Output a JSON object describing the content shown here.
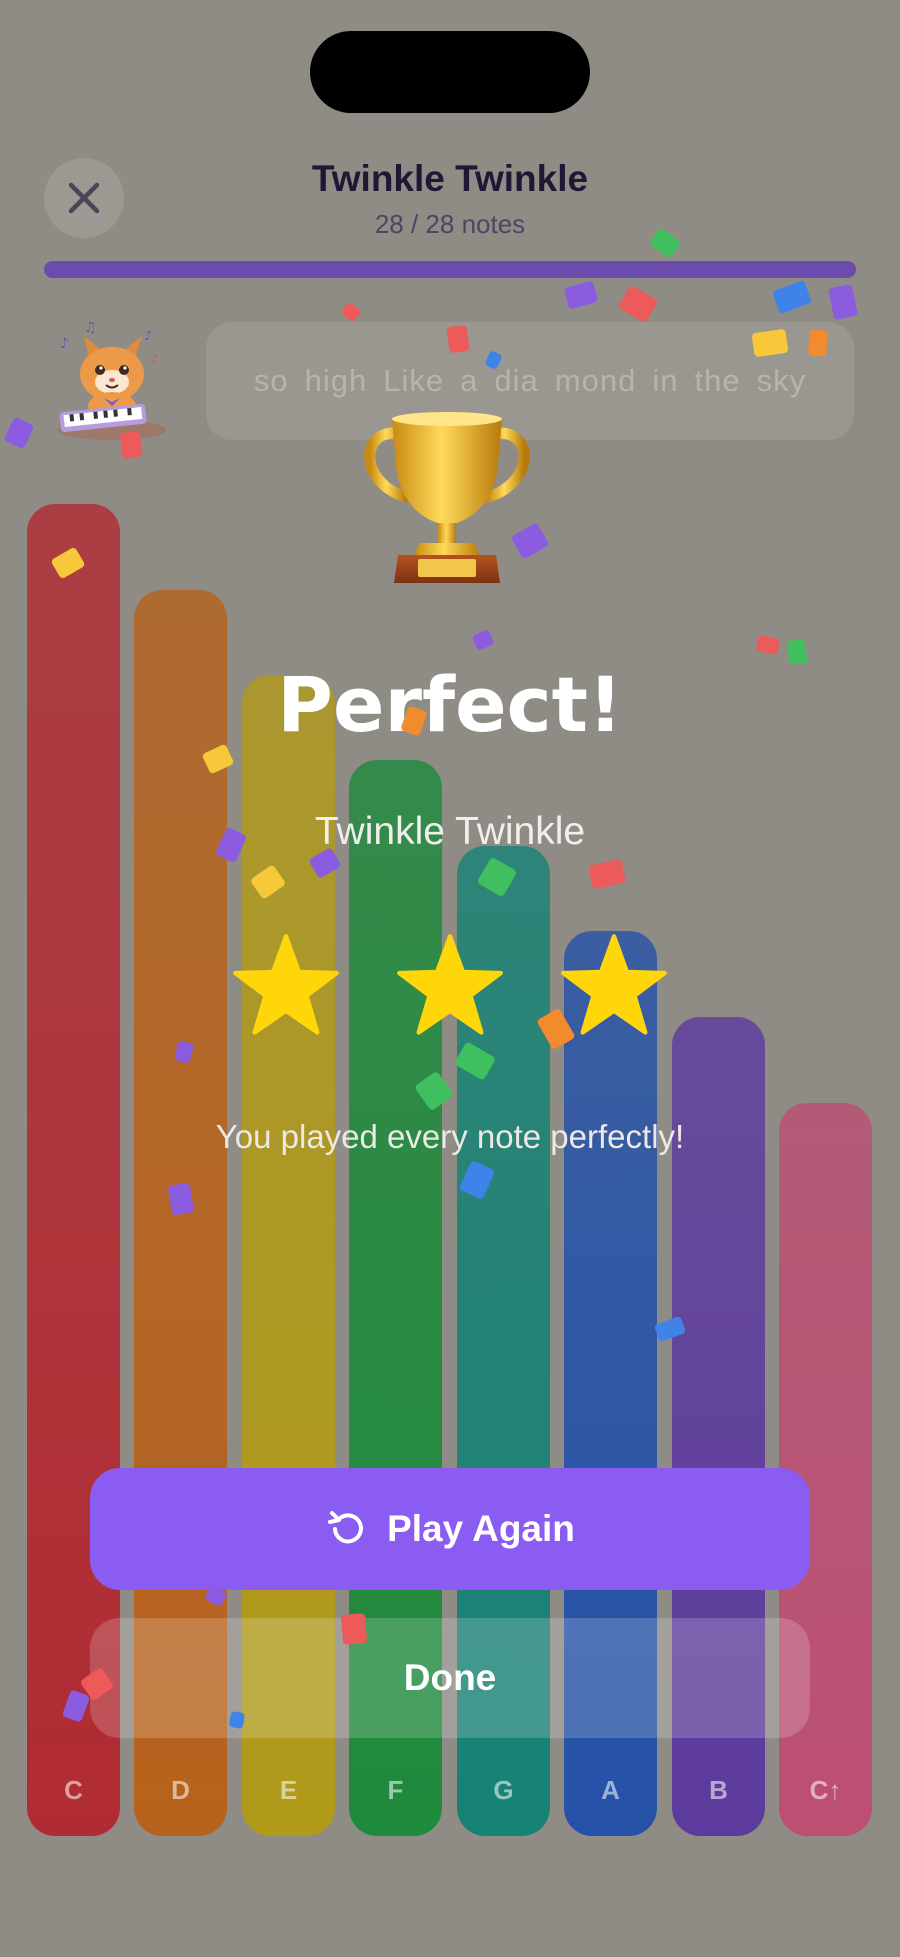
{
  "header": {
    "title": "Twinkle Twinkle",
    "notes_count": "28 / 28 notes",
    "progress": 1.0
  },
  "lyrics": {
    "words": [
      "so",
      "high",
      "Like",
      "a",
      "dia",
      "mond",
      "in",
      "the",
      "sky"
    ]
  },
  "keys": [
    {
      "label": "C",
      "color": "#b12b33"
    },
    {
      "label": "D",
      "color": "#b7621c"
    },
    {
      "label": "E",
      "color": "#b19a1a"
    },
    {
      "label": "F",
      "color": "#1e8a3c"
    },
    {
      "label": "G",
      "color": "#168274"
    },
    {
      "label": "A",
      "color": "#2552a8"
    },
    {
      "label": "B",
      "color": "#5d3b9e"
    },
    {
      "label": "C↑",
      "color": "#bc4f72"
    }
  ],
  "result": {
    "headline": "Perfect!",
    "song_title": "Twinkle Twinkle",
    "stars_earned": 3,
    "stars_total": 3,
    "message": "You played every note perfectly!"
  },
  "buttons": {
    "play_again": "Play Again",
    "done": "Done"
  },
  "icons": {
    "close": "close-icon",
    "replay": "replay-icon",
    "star": "star-icon",
    "trophy": "trophy-icon",
    "mascot": "cat-piano-mascot"
  },
  "colors": {
    "accent": "#8b5cf1",
    "star": "#ffd60a",
    "progress": "#6b4cac"
  }
}
